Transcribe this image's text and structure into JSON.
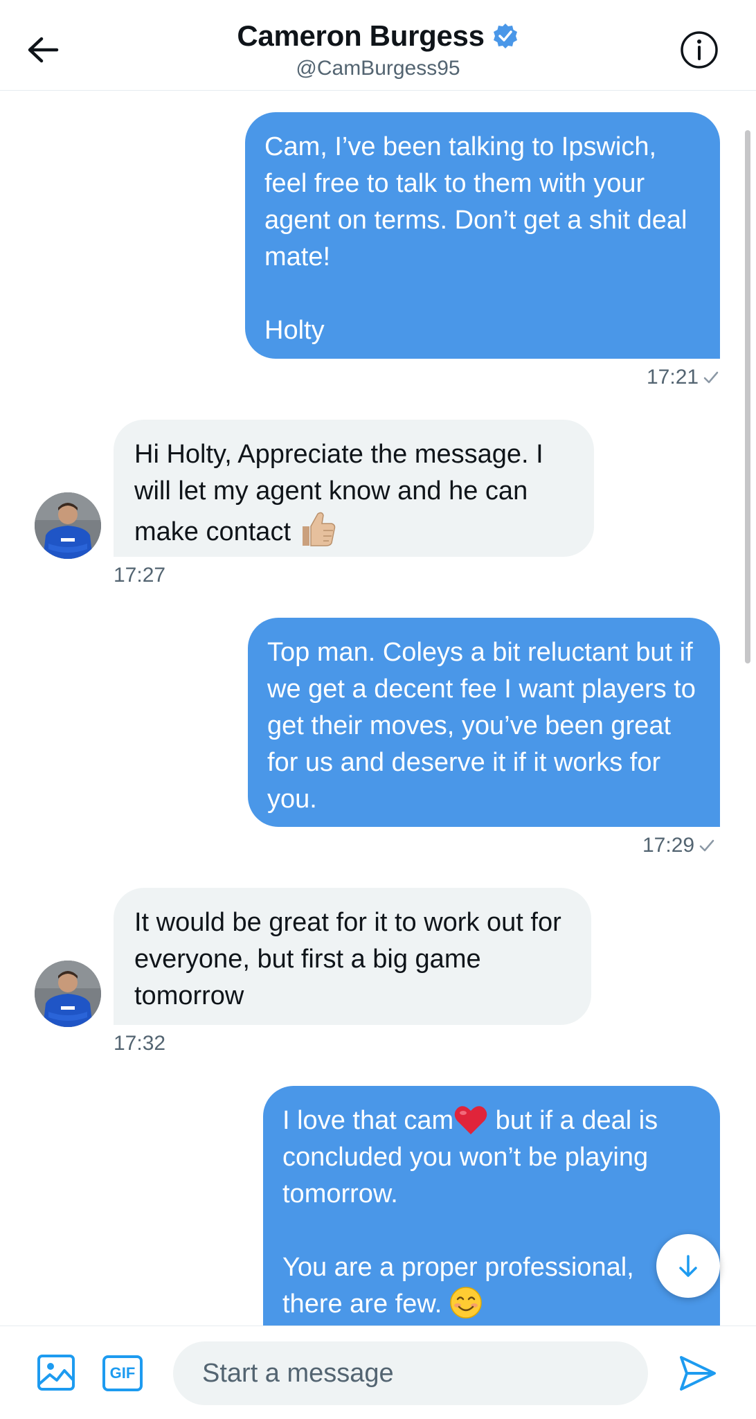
{
  "header": {
    "title": "Cameron Burgess",
    "handle": "@CamBurgess95",
    "verified_color": "#4a97e8"
  },
  "messages": [
    {
      "direction": "out",
      "text": "Cam, I’ve been talking to Ipswich, feel free to talk to them with your agent on terms. Don’t get a shit deal mate!\n\nHolty",
      "time": "17:21"
    },
    {
      "direction": "in",
      "text": "Hi Holty, Appreciate the message. I will let my agent know and he can make contact",
      "emoji": "thumbs-up",
      "time": "17:27"
    },
    {
      "direction": "out",
      "text": "Top man. Coleys a bit reluctant but if we get a decent fee I want players to get their moves, you’ve been great for us and deserve it if it works for you.",
      "time": "17:29"
    },
    {
      "direction": "in",
      "text": "It would be great for it to work out for everyone, but first a big game tomorrow",
      "time": "17:32"
    },
    {
      "direction": "out",
      "text_before_emoji": "I love that cam",
      "emoji_1": "red-heart",
      "text_after_emoji": " but if a deal is concluded you won’t be playing tomorrow.\n\nYou are a proper professional, there are few.",
      "emoji_2": "smiling-face"
    }
  ],
  "composer": {
    "placeholder": "Start a message",
    "gif_label": "GIF"
  },
  "colors": {
    "outgoing_bubble": "#4a97e8",
    "incoming_bubble": "#eff3f4",
    "accent": "#1d9bf0"
  }
}
